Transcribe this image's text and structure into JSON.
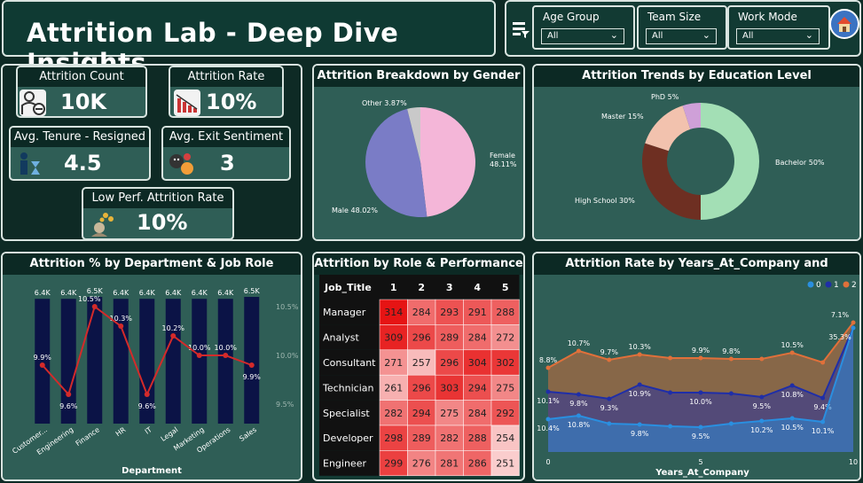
{
  "header": {
    "title": "Attrition Lab - Deep Dive Insights"
  },
  "slicers": [
    {
      "label": "Age Group",
      "value": "All"
    },
    {
      "label": "Team Size",
      "value": "All"
    },
    {
      "label": "Work Mode",
      "value": "All"
    }
  ],
  "kpis": {
    "attrition_count": {
      "label": "Attrition Count",
      "value": "10K"
    },
    "attrition_rate": {
      "label": "Attrition Rate",
      "value": "10%"
    },
    "avg_tenure": {
      "label": "Avg. Tenure - Resigned",
      "value": "4.5"
    },
    "avg_exit": {
      "label": "Avg. Exit Sentiment",
      "value": "3"
    },
    "low_perf": {
      "label": "Low Perf. Attrition Rate",
      "value": "10%"
    }
  },
  "chart_data": [
    {
      "type": "pie",
      "title": "Attrition Breakdown by Gender",
      "labels": [
        "Female 48.11%",
        "Male 48.02%",
        "Other 3.87%"
      ],
      "slices": [
        {
          "name": "Female",
          "value": 48.11,
          "color": "#f4b6d8"
        },
        {
          "name": "Male",
          "value": 48.02,
          "color": "#7a7cc6"
        },
        {
          "name": "Other",
          "value": 3.87,
          "color": "#c9c9c9"
        }
      ]
    },
    {
      "type": "pie",
      "title": "Attrition Trends by Education Level",
      "labels": [
        "Bachelor 50%",
        "High School 30%",
        "Master 15%",
        "PhD 5%"
      ],
      "slices": [
        {
          "name": "Bachelor",
          "value": 50,
          "color": "#a3dfb5"
        },
        {
          "name": "High School",
          "value": 30,
          "color": "#6e2f22"
        },
        {
          "name": "Master",
          "value": 15,
          "color": "#f2c2ae"
        },
        {
          "name": "PhD",
          "value": 5,
          "color": "#cfa0d8"
        }
      ]
    },
    {
      "type": "bar",
      "title": "Attrition % by Department & Job Role",
      "xlabel": "Department",
      "categories": [
        "Customer...",
        "Engineering",
        "Finance",
        "HR",
        "IT",
        "Legal",
        "Marketing",
        "Operations",
        "Sales"
      ],
      "bar_labels": [
        "6.4K",
        "6.4K",
        "6.5K",
        "6.4K",
        "6.4K",
        "6.4K",
        "6.4K",
        "6.4K",
        "6.5K"
      ],
      "bar_values": [
        6.4,
        6.4,
        6.5,
        6.4,
        6.4,
        6.4,
        6.4,
        6.4,
        6.5
      ],
      "line_values": [
        9.9,
        9.6,
        10.5,
        10.3,
        9.6,
        10.2,
        10.0,
        10.0,
        9.9
      ],
      "line_labels": [
        "9.9%",
        "9.6%",
        "10.5%",
        "10.3%",
        "9.6%",
        "10.2%",
        "10.0%",
        "10.0%",
        "9.9%"
      ],
      "y2_ticks": [
        "10.5%",
        "10.0%",
        "9.5%"
      ],
      "y2lim": [
        9.3,
        10.6
      ],
      "colors": {
        "bar": "#0b1346",
        "line": "#d42a2a"
      }
    },
    {
      "type": "heatmap",
      "title": "Attrition by Role & Performance",
      "row_header": "Job_Title",
      "columns": [
        "1",
        "2",
        "3",
        "4",
        "5"
      ],
      "rows": [
        {
          "label": "Manager",
          "values": [
            314,
            284,
            293,
            291,
            288
          ]
        },
        {
          "label": "Analyst",
          "values": [
            309,
            296,
            289,
            284,
            272
          ]
        },
        {
          "label": "Consultant",
          "values": [
            271,
            257,
            296,
            304,
            302
          ]
        },
        {
          "label": "Technician",
          "values": [
            261,
            296,
            303,
            294,
            275
          ]
        },
        {
          "label": "Specialist",
          "values": [
            282,
            294,
            275,
            284,
            292
          ]
        },
        {
          "label": "Developer",
          "values": [
            298,
            289,
            282,
            288,
            254
          ]
        },
        {
          "label": "Engineer",
          "values": [
            299,
            276,
            281,
            286,
            251
          ]
        }
      ]
    },
    {
      "type": "area",
      "title": "Attrition Rate by Years_At_Company and Promotions",
      "xlabel": "Years_At_Company",
      "legend": [
        "0",
        "1",
        "2"
      ],
      "xticks": [
        "0",
        "5",
        "10"
      ],
      "x": [
        0,
        1,
        2,
        3,
        4,
        5,
        6,
        7,
        8,
        9,
        10
      ],
      "series": [
        {
          "name": "2",
          "color": "#e0703a",
          "values": [
            8.8,
            10.7,
            9.7,
            10.3,
            9.9,
            9.9,
            9.8,
            9.8,
            10.5,
            9.4,
            7.1
          ],
          "labels": [
            "8.8%",
            "10.7%",
            "9.7%",
            "10.3%",
            "",
            "9.9%",
            "9.8%",
            "",
            "10.5%",
            "",
            "7.1%"
          ]
        },
        {
          "name": "1",
          "color": "#1f2ea8",
          "values": [
            10.1,
            9.8,
            9.3,
            10.9,
            10.0,
            10.0,
            9.9,
            9.5,
            10.8,
            9.4,
            35.3
          ],
          "labels": [
            "10.1%",
            "9.8%",
            "9.3%",
            "10.9%",
            "",
            "10.0%",
            "",
            "9.5%",
            "10.8%",
            "9.4%",
            ""
          ]
        },
        {
          "name": "0",
          "color": "#2a8fe0",
          "values": [
            10.4,
            10.8,
            9.9,
            9.8,
            9.6,
            9.5,
            9.9,
            10.2,
            10.5,
            10.1,
            35.3
          ],
          "labels": [
            "10.4%",
            "10.8%",
            "",
            "9.8%",
            "",
            "9.5%",
            "",
            "10.2%",
            "10.5%",
            "10.1%",
            "35.3%"
          ]
        }
      ]
    }
  ]
}
